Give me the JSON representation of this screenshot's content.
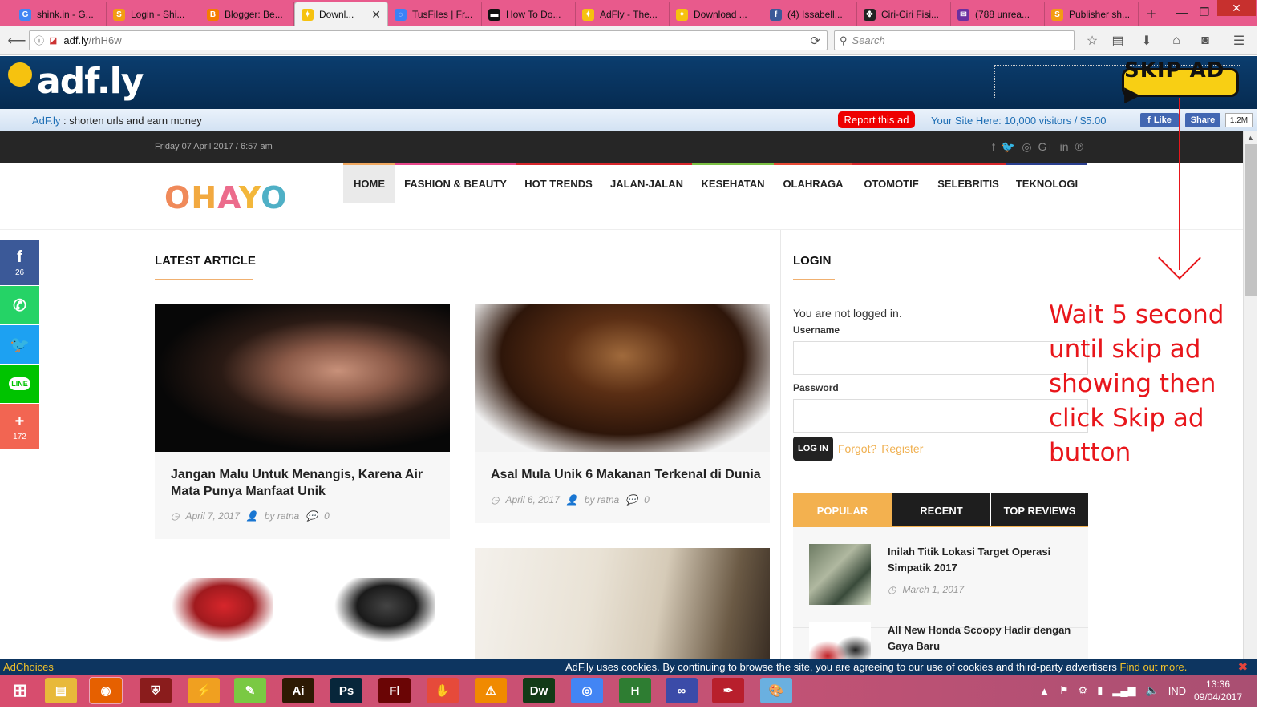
{
  "browser": {
    "tabs": [
      {
        "title": "shink.in - G...",
        "icon": "google-icon",
        "color": "#4285f4",
        "glyph": "G"
      },
      {
        "title": "Login - Shi...",
        "icon": "shink-icon",
        "color": "#f39c12",
        "glyph": "S"
      },
      {
        "title": "Blogger: Be...",
        "icon": "blogger-icon",
        "color": "#f57d00",
        "glyph": "B"
      },
      {
        "title": "Downl...",
        "icon": "adfly-bee-icon",
        "color": "#f6c20f",
        "glyph": "✦",
        "active": true
      },
      {
        "title": "TusFiles | Fr...",
        "icon": "loading-icon",
        "color": "#3b82f6",
        "glyph": "◌"
      },
      {
        "title": "How To Do...",
        "icon": "page-icon",
        "color": "#111111",
        "glyph": "▬"
      },
      {
        "title": "AdFly - The...",
        "icon": "adfly-bee-icon",
        "color": "#f6c20f",
        "glyph": "✦"
      },
      {
        "title": "Download ...",
        "icon": "adfly-bee-icon",
        "color": "#f6c20f",
        "glyph": "✦"
      },
      {
        "title": "(4) Issabell...",
        "icon": "facebook-icon",
        "color": "#3b5998",
        "glyph": "f"
      },
      {
        "title": "Ciri-Ciri Fisi...",
        "icon": "site-icon",
        "color": "#222222",
        "glyph": "✤"
      },
      {
        "title": "(788 unrea...",
        "icon": "yahoo-mail-icon",
        "color": "#6b2fa0",
        "glyph": "✉"
      },
      {
        "title": "Publisher sh...",
        "icon": "shink-icon",
        "color": "#f39c12",
        "glyph": "S"
      }
    ],
    "url_host": "adf.ly",
    "url_path": "/rhH6w",
    "search_placeholder": "Search"
  },
  "adfly": {
    "logo_text": "adf.ly",
    "skip_label": "SKIP AD ▶",
    "tagline_brand": "AdF.ly",
    "tagline_rest": " : shorten urls and earn money",
    "report_label": "Report this ad",
    "your_site": "Your Site Here: 10,000 visitors / $5.00",
    "fb_like": "Like",
    "fb_share": "Share",
    "fb_count": "1.2M"
  },
  "site": {
    "date": "Friday 07 April 2017 / 6:57 am",
    "social": [
      "f",
      "🐦",
      "◎",
      "G+",
      "in",
      "℗"
    ],
    "logo_letters": [
      "O",
      "H",
      "A",
      "Y",
      "O"
    ],
    "nav": [
      {
        "label": "HOME",
        "color": "#f0a860",
        "active": true
      },
      {
        "label": "FASHION & BEAUTY",
        "color": "#e8468b"
      },
      {
        "label": "HOT TRENDS",
        "color": "#d7262b"
      },
      {
        "label": "JALAN-JALAN",
        "color": "#d7262b"
      },
      {
        "label": "KESEHATAN",
        "color": "#7bc043"
      },
      {
        "label": "OLAHRAGA",
        "color": "#e84a35"
      },
      {
        "label": "OTOMOTIF",
        "color": "#d7262b"
      },
      {
        "label": "SELEBRITIS",
        "color": "#d7262b"
      },
      {
        "label": "TEKNOLOGI",
        "color": "#2a3f8f"
      }
    ],
    "latest_title": "LATEST ARTICLE",
    "articles": [
      {
        "title": "Jangan Malu Untuk Menangis, Karena Air Mata Punya Manfaat Unik",
        "date": "April 7, 2017",
        "author": "by ratna",
        "comments": "0"
      },
      {
        "title": "Asal Mula Unik 6 Makanan Terkenal di Dunia",
        "date": "April 6, 2017",
        "author": "by ratna",
        "comments": "0"
      }
    ],
    "login": {
      "title": "LOGIN",
      "status": "You are not logged in.",
      "username_label": "Username",
      "password_label": "Password",
      "login_button": "LOG IN",
      "forgot": "Forgot?",
      "register": "Register"
    },
    "widget_tabs": [
      "POPULAR",
      "RECENT",
      "TOP REVIEWS"
    ],
    "popular": [
      {
        "title": "Inilah Titik Lokasi Target Operasi Simpatik 2017",
        "date": "March 1, 2017"
      },
      {
        "title": "All New Honda Scoopy Hadir dengan Gaya Baru",
        "date": ""
      }
    ],
    "share_bar": [
      {
        "name": "facebook",
        "glyph": "f",
        "color": "#3b5998",
        "count": "26"
      },
      {
        "name": "whatsapp",
        "glyph": "✆",
        "color": "#25d366",
        "count": ""
      },
      {
        "name": "twitter",
        "glyph": "🐦",
        "color": "#1da1f2",
        "count": ""
      },
      {
        "name": "line",
        "glyph": "LINE",
        "color": "#00c300",
        "count": ""
      },
      {
        "name": "more",
        "glyph": "+",
        "color": "#f26552",
        "count": "172"
      }
    ]
  },
  "annotation": {
    "instruction": "Wait 5 second until skip ad showing then click Skip ad button"
  },
  "cookie": {
    "adchoices": "AdChoices",
    "message": "AdF.ly uses cookies. By continuing to browse the site, you are agreeing to our use of cookies and third-party advertisers ",
    "find_out": "Find out more.",
    "close": "✖"
  },
  "taskbar": {
    "apps": [
      {
        "name": "start",
        "glyph": "⊞",
        "color": "transparent"
      },
      {
        "name": "file-explorer",
        "glyph": "▤",
        "color": "#e8b93a"
      },
      {
        "name": "firefox",
        "glyph": "◉",
        "color": "#e66000"
      },
      {
        "name": "shield-app",
        "glyph": "⛨",
        "color": "#8a1c1c"
      },
      {
        "name": "tool-app",
        "glyph": "⚡",
        "color": "#f0a020"
      },
      {
        "name": "green-app",
        "glyph": "✎",
        "color": "#7ac943"
      },
      {
        "name": "illustrator",
        "glyph": "Ai",
        "color": "#2d1a03"
      },
      {
        "name": "photoshop",
        "glyph": "Ps",
        "color": "#07263a"
      },
      {
        "name": "flash",
        "glyph": "Fl",
        "color": "#6a0505"
      },
      {
        "name": "camera-app",
        "glyph": "✋",
        "color": "#e64a3a"
      },
      {
        "name": "vlc",
        "glyph": "⚠",
        "color": "#f08a00"
      },
      {
        "name": "dreamweaver",
        "glyph": "Dw",
        "color": "#123b17"
      },
      {
        "name": "chrome",
        "glyph": "◎",
        "color": "#4285f4"
      },
      {
        "name": "h-app",
        "glyph": "H",
        "color": "#2e7d32"
      },
      {
        "name": "infinity-app",
        "glyph": "∞",
        "color": "#3b4ba8"
      },
      {
        "name": "acrobat",
        "glyph": "✒",
        "color": "#b81f2c"
      },
      {
        "name": "paint",
        "glyph": "🎨",
        "color": "#6ab0e0"
      }
    ],
    "lang": "IND",
    "time": "13:36",
    "date": "09/04/2017"
  }
}
